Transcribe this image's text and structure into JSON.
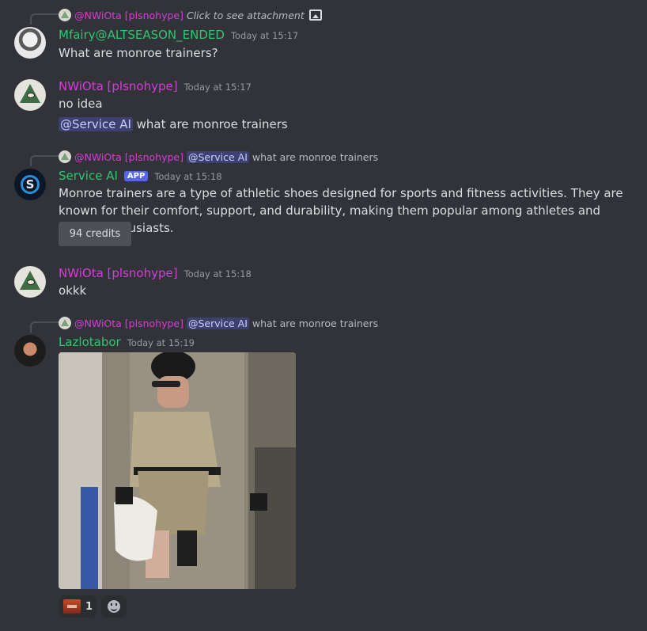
{
  "messages": [
    {
      "reply": {
        "author": "@NWiOta [plsnohype]",
        "text": "Click to see attachment"
      },
      "author": "Mfairy@ALTSEASON_ENDED",
      "author_color": "#2dc770",
      "time": "Today at 15:17",
      "lines": [
        "What are monroe trainers?"
      ]
    },
    {
      "author": "NWiOta [plsnohype]",
      "author_color": "#d83cd8",
      "time": "Today at 15:17",
      "lines": [
        "no idea"
      ],
      "mention_line": {
        "mention": "@Service AI",
        "text": " what are monroe trainers"
      }
    },
    {
      "reply": {
        "author": "@NWiOta [plsnohype]",
        "mention": "@Service AI",
        "text": "what are monroe trainers"
      },
      "author": "Service AI",
      "author_color": "#2dc770",
      "tag": "APP",
      "time": "Today at 15:18",
      "lines": [
        "Monroe trainers are a type of athletic shoes designed for sports and fitness activities. They are known for their comfort, support, and durability, making them popular among athletes and fitness enthusiasts."
      ],
      "button": "94 credits"
    },
    {
      "author": "NWiOta [plsnohype]",
      "author_color": "#d83cd8",
      "time": "Today at 15:18",
      "lines": [
        "okkk"
      ]
    },
    {
      "reply": {
        "author": "@NWiOta [plsnohype]",
        "mention": "@Service AI",
        "text": "what are monroe trainers"
      },
      "author": "Lazlotabor",
      "author_color": "#2dc770",
      "time": "Today at 15:19",
      "reaction": {
        "count": "1"
      }
    }
  ],
  "icons": {
    "attachment": "image-icon",
    "add_reaction": "smile-icon"
  }
}
